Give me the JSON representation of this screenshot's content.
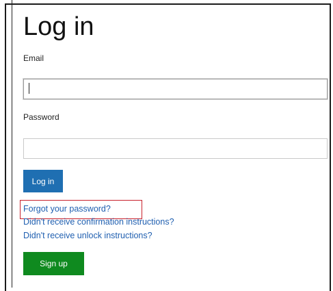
{
  "page": {
    "title": "Log in"
  },
  "form": {
    "email_label": "Email",
    "email_value": "",
    "password_label": "Password",
    "password_value": ""
  },
  "buttons": {
    "login_label": "Log in",
    "signup_label": "Sign up"
  },
  "links": {
    "forgot_password": "Forgot your password?",
    "confirmation": "Didn't receive confirmation instructions?",
    "unlock": "Didn't receive unlock instructions?"
  },
  "colors": {
    "primary_button": "#1f6fb2",
    "signup_button": "#0f8a1f",
    "link": "#1f5fb0",
    "highlight_border": "#c8202b"
  }
}
